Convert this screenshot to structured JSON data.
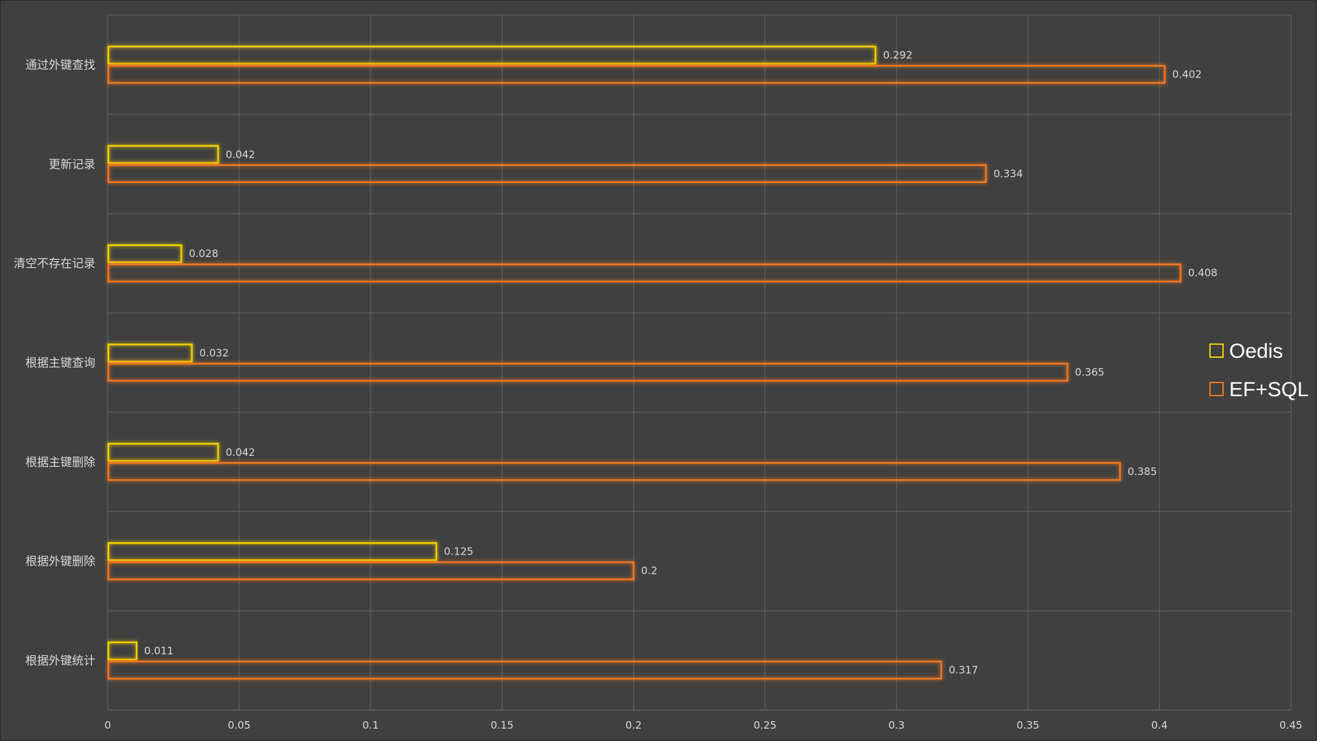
{
  "chart_data": {
    "type": "bar",
    "orientation": "horizontal",
    "categories": [
      "通过外键查找",
      "更新记录",
      "清空不存在记录",
      "根据主键查询",
      "根据主键删除",
      "根据外键删除",
      "根据外键统计"
    ],
    "series": [
      {
        "name": "Oedis",
        "values": [
          0.292,
          0.042,
          0.028,
          0.032,
          0.042,
          0.125,
          0.011
        ],
        "labels": [
          "0.292",
          "0.042",
          "0.028",
          "0.032",
          "0.042",
          "0.125",
          "0.011"
        ],
        "color": "#f2d000"
      },
      {
        "name": "EF+SQL",
        "values": [
          0.402,
          0.334,
          0.408,
          0.365,
          0.385,
          0.2,
          0.317
        ],
        "labels": [
          "0.402",
          "0.334",
          "0.408",
          "0.365",
          "0.385",
          "0.2",
          "0.317"
        ],
        "color": "#f07820"
      }
    ],
    "xlim": [
      0,
      0.45
    ],
    "xticks": [
      "0",
      "0.05",
      "0.1",
      "0.15",
      "0.2",
      "0.25",
      "0.3",
      "0.35",
      "0.4",
      "0.45"
    ],
    "grid": true,
    "legend": "right",
    "bar_style": "outlined with glow",
    "background": "#404040"
  }
}
